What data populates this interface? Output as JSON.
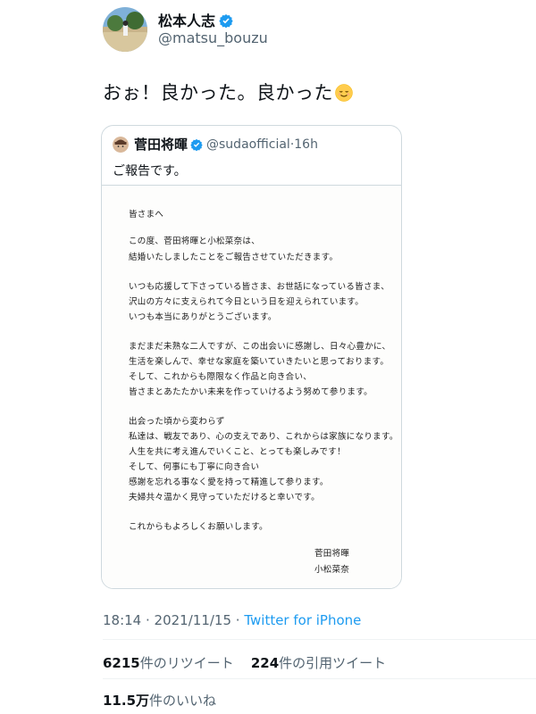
{
  "author": {
    "display_name": "松本人志",
    "handle": "@matsu_bouzu"
  },
  "tweet": {
    "text": "おぉ！良かった。良かった",
    "emoji": "relieved-face"
  },
  "quoted": {
    "display_name": "菅田将暉",
    "handle": "@sudaofficial",
    "dot": "·",
    "time": "16h",
    "text": "ご報告です。",
    "letter": {
      "lines": [
        "皆さまへ",
        "この度、菅田将暉と小松菜奈は、",
        "結婚いたしましたことをご報告させていただきます。",
        "いつも応援して下さっている皆さま、お世話になっている皆さま、",
        "沢山の方々に支えられて今日という日を迎えられています。",
        "いつも本当にありがとうございます。",
        "まだまだ未熟な二人ですが、この出会いに感謝し、日々心豊かに、",
        "生活を楽しんで、幸せな家庭を築いていきたいと思っております。",
        "そして、これからも際限なく作品と向き合い、",
        "皆さまとあたたかい未来を作っていけるよう努めて参ります。",
        "出会った頃から変わらず",
        "私達は、戦友であり、心の支えであり、これからは家族になります。",
        "人生を共に考え進んでいくこと、とっても楽しみです！",
        "そして、何事にも丁寧に向き合い",
        "感謝を忘れる事なく愛を持って精進して参ります。",
        "夫婦共々温かく見守っていただけると幸いです。",
        "これからもよろしくお願いします。",
        "菅田将暉",
        "小松菜奈"
      ]
    }
  },
  "meta": {
    "time": "18:14",
    "sep": " · ",
    "date": "2021/11/15",
    "app": "Twitter for iPhone"
  },
  "stats": {
    "retweets_count": "6215",
    "retweets_label": "件のリツイート",
    "quotes_count": "224",
    "quotes_label": "件の引用ツイート",
    "likes_count": "11.5万",
    "likes_label": "件のいいね"
  },
  "colors": {
    "verified": "#1d9bf0",
    "link": "#1d9bf0",
    "secondary_text": "#536471"
  }
}
